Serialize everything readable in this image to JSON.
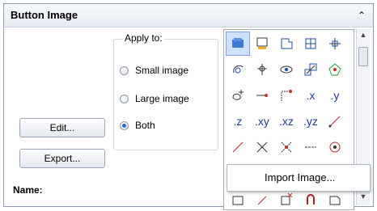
{
  "panel": {
    "title": "Button Image"
  },
  "apply_to": {
    "label": "Apply to:",
    "options": [
      "Small image",
      "Large image",
      "Both"
    ],
    "selected": "Both"
  },
  "buttons": {
    "edit": "Edit...",
    "export": "Export..."
  },
  "name_label": "Name:",
  "icons": {
    "row3": [
      ".x",
      ".y"
    ],
    "row4": [
      ".z",
      ".xy",
      ".xz",
      ".yz"
    ]
  },
  "context_menu": {
    "import_image": "Import Image..."
  },
  "colors": {
    "accent": "#2a6bd0",
    "selection": "#cfe2fb"
  }
}
